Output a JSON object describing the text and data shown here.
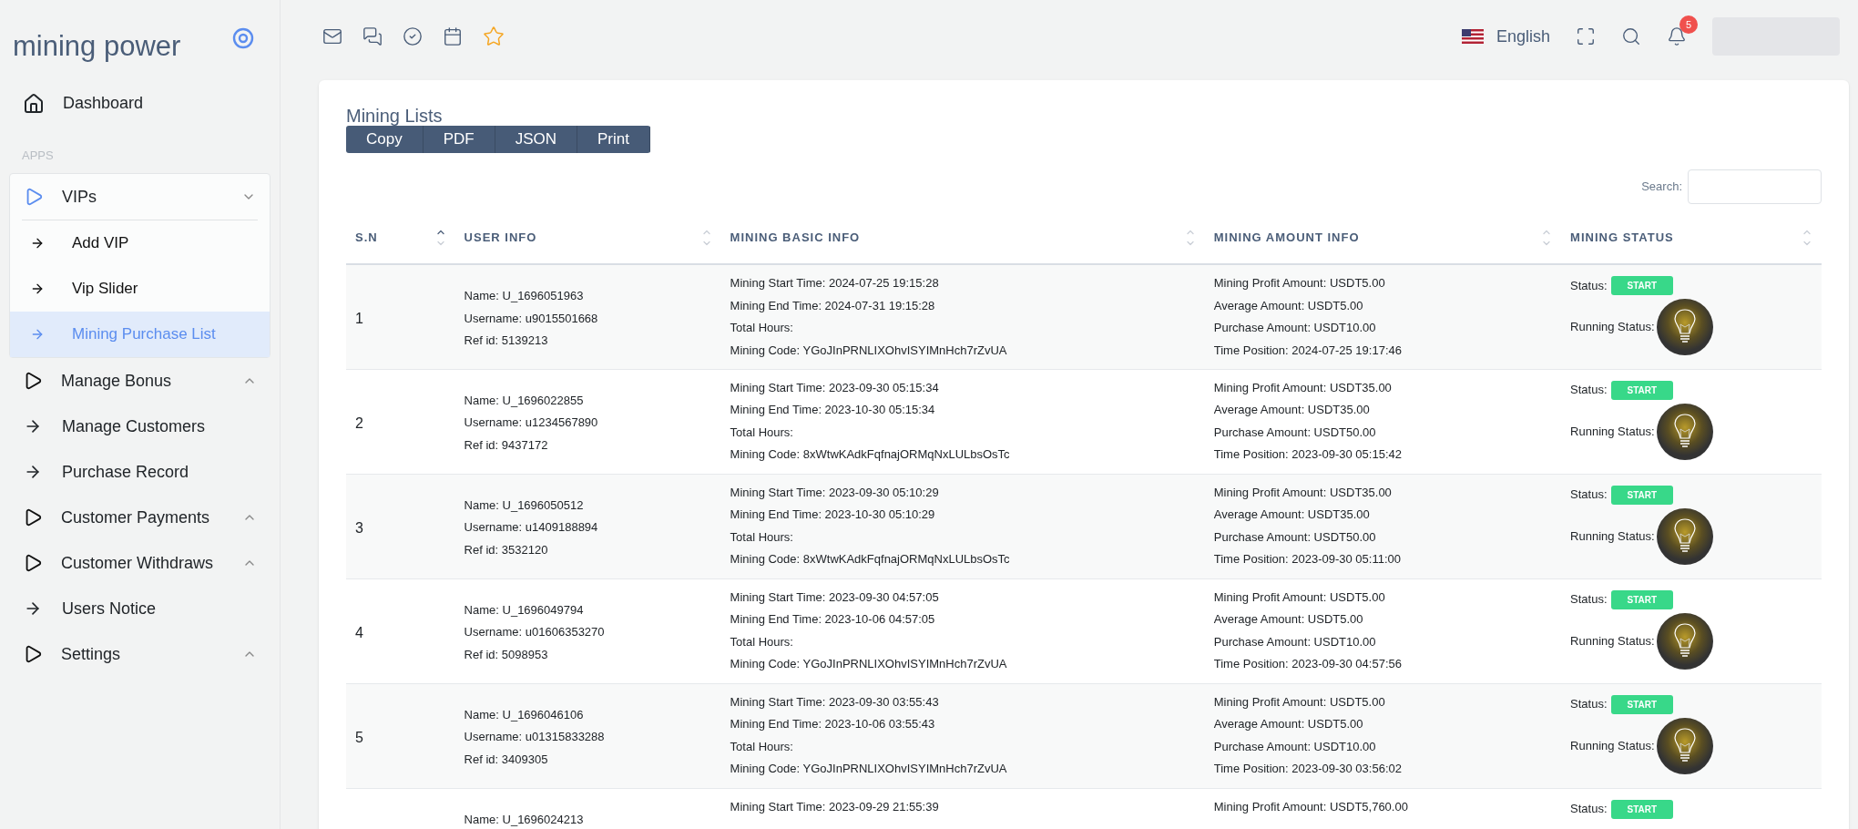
{
  "sidebar": {
    "logo": "mining power",
    "dashboard": "Dashboard",
    "section_label": "APPS",
    "items": [
      {
        "kind": "group",
        "label": "VIPs",
        "expanded": true,
        "children": [
          {
            "label": "Add VIP",
            "selected": false
          },
          {
            "label": "Vip Slider",
            "selected": false
          },
          {
            "label": "Mining Purchase List",
            "selected": true
          }
        ]
      },
      {
        "kind": "group",
        "label": "Manage Bonus",
        "expanded": false
      },
      {
        "kind": "link",
        "label": "Manage Customers"
      },
      {
        "kind": "link",
        "label": "Purchase Record"
      },
      {
        "kind": "group",
        "label": "Customer Payments",
        "expanded": false
      },
      {
        "kind": "group",
        "label": "Customer Withdraws",
        "expanded": false
      },
      {
        "kind": "link",
        "label": "Users Notice"
      },
      {
        "kind": "group",
        "label": "Settings",
        "expanded": false
      }
    ]
  },
  "topbar": {
    "language": "English",
    "notification_count": "5"
  },
  "card": {
    "title": "Mining Lists",
    "export_buttons": [
      "Copy",
      "PDF",
      "JSON",
      "Print"
    ],
    "search_label": "Search:",
    "table": {
      "columns": [
        {
          "label": "S.N",
          "sorted": true
        },
        {
          "label": "USER INFO",
          "sorted": false
        },
        {
          "label": "MINING BASIC INFO",
          "sorted": false
        },
        {
          "label": "MINING AMOUNT INFO",
          "sorted": false
        },
        {
          "label": "MINING STATUS",
          "sorted": false
        }
      ],
      "rows": [
        {
          "sn": "1",
          "user_info": [
            "Name: U_1696051963",
            "Username: u9015501668",
            "Ref id: 5139213"
          ],
          "basic_info": [
            "Mining Start Time: 2024-07-25 19:15:28",
            "Mining End Time: 2024-07-31 19:15:28",
            "Total Hours:",
            "Mining Code: YGoJInPRNLIXOhvISYIMnHch7rZvUA"
          ],
          "amount_info": [
            "Mining Profit Amount: USDT5.00",
            "Average Amount: USDT5.00",
            "Purchase Amount: USDT10.00",
            "Time Position: 2024-07-25 19:17:46"
          ],
          "status_label": "Status:",
          "status": "START",
          "running_label": "Running Status:",
          "running": true
        },
        {
          "sn": "2",
          "user_info": [
            "Name: U_1696022855",
            "Username: u1234567890",
            "Ref id: 9437172"
          ],
          "basic_info": [
            "Mining Start Time: 2023-09-30 05:15:34",
            "Mining End Time: 2023-10-30 05:15:34",
            "Total Hours:",
            "Mining Code: 8xWtwKAdkFqfnajORMqNxLULbsOsTc"
          ],
          "amount_info": [
            "Mining Profit Amount: USDT35.00",
            "Average Amount: USDT35.00",
            "Purchase Amount: USDT50.00",
            "Time Position: 2023-09-30 05:15:42"
          ],
          "status_label": "Status:",
          "status": "START",
          "running_label": "Running Status:",
          "running": true
        },
        {
          "sn": "3",
          "user_info": [
            "Name: U_1696050512",
            "Username: u1409188894",
            "Ref id: 3532120"
          ],
          "basic_info": [
            "Mining Start Time: 2023-09-30 05:10:29",
            "Mining End Time: 2023-10-30 05:10:29",
            "Total Hours:",
            "Mining Code: 8xWtwKAdkFqfnajORMqNxLULbsOsTc"
          ],
          "amount_info": [
            "Mining Profit Amount: USDT35.00",
            "Average Amount: USDT35.00",
            "Purchase Amount: USDT50.00",
            "Time Position: 2023-09-30 05:11:00"
          ],
          "status_label": "Status:",
          "status": "START",
          "running_label": "Running Status:",
          "running": true
        },
        {
          "sn": "4",
          "user_info": [
            "Name: U_1696049794",
            "Username: u01606353270",
            "Ref id: 5098953"
          ],
          "basic_info": [
            "Mining Start Time: 2023-09-30 04:57:05",
            "Mining End Time: 2023-10-06 04:57:05",
            "Total Hours:",
            "Mining Code: YGoJInPRNLIXOhvISYIMnHch7rZvUA"
          ],
          "amount_info": [
            "Mining Profit Amount: USDT5.00",
            "Average Amount: USDT5.00",
            "Purchase Amount: USDT10.00",
            "Time Position: 2023-09-30 04:57:56"
          ],
          "status_label": "Status:",
          "status": "START",
          "running_label": "Running Status:",
          "running": true
        },
        {
          "sn": "5",
          "user_info": [
            "Name: U_1696046106",
            "Username: u01315833288",
            "Ref id: 3409305"
          ],
          "basic_info": [
            "Mining Start Time: 2023-09-30 03:55:43",
            "Mining End Time: 2023-10-06 03:55:43",
            "Total Hours:",
            "Mining Code: YGoJInPRNLIXOhvISYIMnHch7rZvUA"
          ],
          "amount_info": [
            "Mining Profit Amount: USDT5.00",
            "Average Amount: USDT5.00",
            "Purchase Amount: USDT10.00",
            "Time Position: 2023-09-30 03:56:02"
          ],
          "status_label": "Status:",
          "status": "START",
          "running_label": "Running Status:",
          "running": true
        },
        {
          "user_info": [
            "Name: U_1696024213"
          ],
          "basic_info": [
            "Mining Start Time: 2023-09-29 21:55:39"
          ],
          "amount_info": [
            "Mining Profit Amount: USDT5,760.00"
          ],
          "status_label": "Status:",
          "status": "START"
        }
      ]
    }
  }
}
